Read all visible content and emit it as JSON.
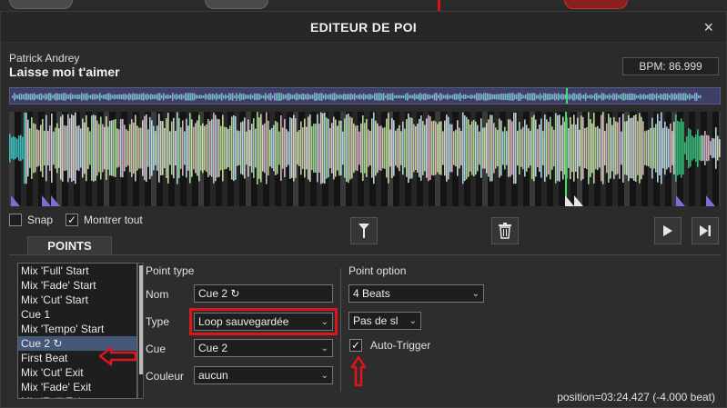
{
  "dialog": {
    "title": "EDITEUR DE POI",
    "close_symbol": "×"
  },
  "track": {
    "artist": "Patrick Andrey",
    "title": "Laisse moi t'aimer",
    "bpm": "BPM: 86.999"
  },
  "controls": {
    "snap_label": "Snap",
    "snap_checked": false,
    "show_all_label": "Montrer tout",
    "show_all_checked": true,
    "check_mark": "✓"
  },
  "tabs": [
    {
      "label": "POINTS"
    }
  ],
  "poi_list": {
    "items": [
      {
        "label": "Mix 'Full' Start"
      },
      {
        "label": "Mix 'Fade' Start"
      },
      {
        "label": "Mix 'Cut' Start"
      },
      {
        "label": "Cue 1"
      },
      {
        "label": "Mix 'Tempo' Start"
      },
      {
        "label": "Cue 2 ↻",
        "selected": true
      },
      {
        "label": "First Beat"
      },
      {
        "label": "Mix 'Cut' Exit"
      },
      {
        "label": "Mix 'Fade' Exit"
      },
      {
        "label": "Mix 'Full' Exit"
      }
    ]
  },
  "point_type": {
    "section_label": "Point type",
    "name_label": "Nom",
    "name_value": "Cue 2 ↻",
    "type_label": "Type",
    "type_value": "Loop sauvegardée",
    "cue_label": "Cue",
    "cue_value": "Cue 2",
    "color_label": "Couleur",
    "color_value": "aucun"
  },
  "point_option": {
    "section_label": "Point option",
    "beats_value": "4 Beats",
    "slip_value": "Pas de sl",
    "auto_trigger_label": "Auto-Trigger",
    "auto_trigger_checked": true
  },
  "status": {
    "position": "position=03:24.427 (-4.000 beat)"
  },
  "colors": {
    "highlight": "#e0141b",
    "selection": "#46587a",
    "overview_bg": "#3e3f66",
    "cue_marker": "#7b6fd6"
  },
  "icons": [
    "marker-pin-icon",
    "trash-icon",
    "play-icon",
    "skip-end-icon",
    "close-icon"
  ]
}
